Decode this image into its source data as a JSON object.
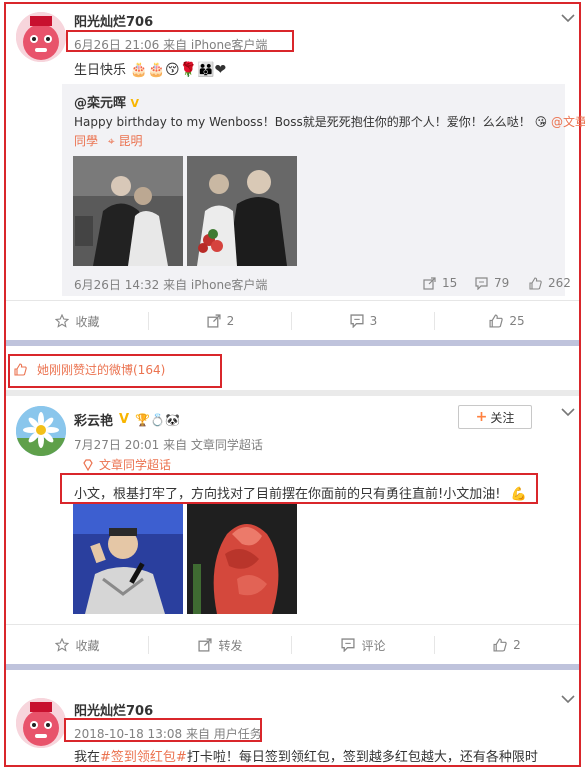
{
  "post1": {
    "username": "阳光灿烂706",
    "meta": "6月26日 21:06 来自 iPhone客户端",
    "text": "生日快乐",
    "repost": {
      "author": "@栾元晖",
      "text_line1": "Happy birthday to my Wenboss！Boss就是死死抱住你的那个人！爱你！么么哒！",
      "mention_tail": "@文章",
      "text_line2_mention": "同學",
      "location": "昆明",
      "meta": "6月26日 14:32 来自 iPhone客户端",
      "repost_count": "15",
      "comment_count": "79",
      "like_count": "262"
    },
    "actions": {
      "collect": "收藏",
      "repost": "2",
      "comment": "3",
      "like": "25"
    }
  },
  "liked_banner": "她刚刚赞过的微博(164)",
  "post2": {
    "username": "彩云艳",
    "follow_label": "关注",
    "meta": "7月27日 20:01 来自 文章同学超话",
    "topic": "文章同学超话",
    "text": "小文，根基打牢了，方向找对了目前摆在你面前的只有勇往直前!小文加油!",
    "actions": {
      "collect": "收藏",
      "repost": "转发",
      "comment": "评论",
      "like": "2"
    }
  },
  "post3": {
    "username": "阳光灿烂706",
    "meta": "2018-10-18 13:08 来自 用户任务",
    "text_pre": "我在",
    "hashtag": "#签到领红包#",
    "text_post": "打卡啦！每日签到领红包，签到越多红包越大，还有各种限时"
  },
  "colors": {
    "accent": "#eb7350",
    "highlight_box": "#d9262b",
    "vip": "#f8b500"
  }
}
